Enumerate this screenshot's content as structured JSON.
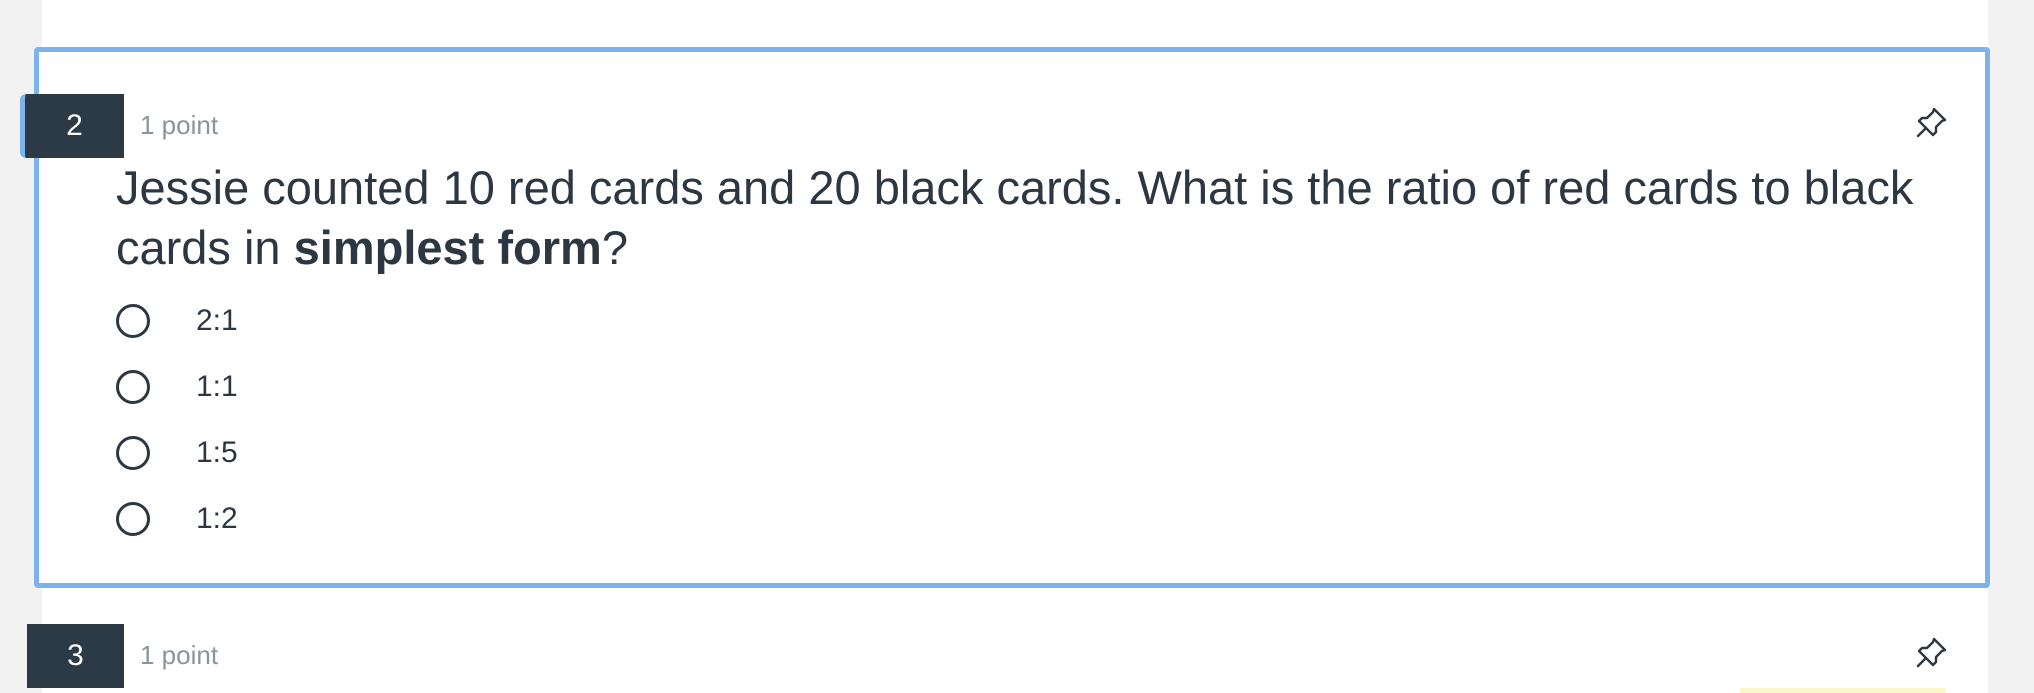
{
  "questions": [
    {
      "number": "2",
      "points": "1 point",
      "pin_icon": "pushpin-icon",
      "text_before": "Jessie counted 10 red cards and 20 black cards. What is the ratio of red cards to black cards in ",
      "text_bold": "simplest form",
      "text_after": "?",
      "options": [
        "2:1",
        "1:1",
        "1:5",
        "1:2"
      ],
      "accent_color": "#7db2ea"
    },
    {
      "number": "3",
      "points": "1 point",
      "pin_icon": "pushpin-icon"
    }
  ],
  "colors": {
    "number_badge": "#2c3a46",
    "text": "#2d3741",
    "points_text": "#8b949c",
    "active_border": "#7db2ea"
  }
}
